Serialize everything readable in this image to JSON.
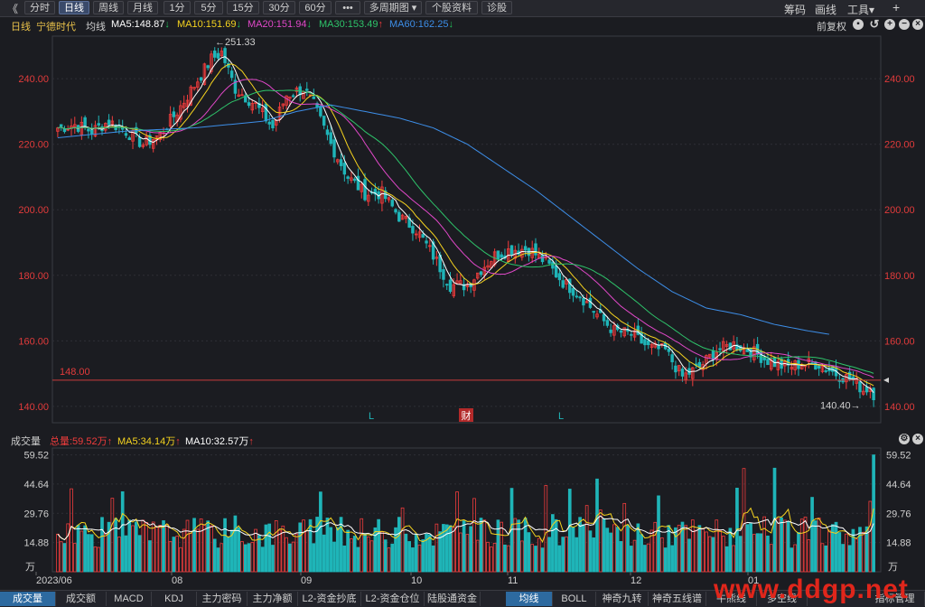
{
  "toolbar": {
    "collapse": "《",
    "buttons": [
      "分时",
      "日线",
      "周线",
      "月线",
      "1分",
      "5分",
      "15分",
      "30分",
      "60分",
      "•••",
      "多周期图",
      "个股资料",
      "诊股"
    ],
    "active": "日线",
    "multi_arrow": "▾",
    "right": [
      "筹码",
      "画线",
      "工具▾"
    ],
    "plus": "+"
  },
  "kline_header": {
    "period": "日线",
    "stock": "宁德时代",
    "ma_label": "均线",
    "ma": [
      {
        "text": "MA5:148.87",
        "arrow": "↓",
        "color": "#ffffff",
        "arrow_color": "#22c05a"
      },
      {
        "text": "MA10:151.69",
        "arrow": "↓",
        "color": "#f5d31f",
        "arrow_color": "#22c05a"
      },
      {
        "text": "MA20:151.94",
        "arrow": "↓",
        "color": "#e048c8",
        "arrow_color": "#22c05a"
      },
      {
        "text": "MA30:153.49",
        "arrow": "↑",
        "color": "#2ec36a",
        "arrow_color": "#f03c3c"
      },
      {
        "text": "MA60:162.25",
        "arrow": "↓",
        "color": "#3d8ee8",
        "arrow_color": "#22c05a"
      }
    ],
    "restore": "前复权"
  },
  "volume_header": {
    "label": "成交量",
    "total": "总量:59.52万",
    "total_arrow": "↑",
    "ma5": "MA5:34.14万",
    "ma5_arrow": "↑",
    "ma10": "MA10:32.57万",
    "ma10_arrow": "↑"
  },
  "price_axis": {
    "ticks": [
      "240.00",
      "220.00",
      "200.00",
      "180.00",
      "160.00",
      "140.00"
    ],
    "values": [
      240,
      220,
      200,
      180,
      160,
      140
    ],
    "min": 135,
    "max": 253
  },
  "price_line": {
    "value": 148.0,
    "label": "148.00"
  },
  "annotations": {
    "high": "251.33",
    "low": "140.40",
    "low_arrow": "→",
    "high_arrow": "←",
    "markers": [
      "L",
      "财",
      "L"
    ]
  },
  "volume_axis": {
    "ticks": [
      "59.52",
      "44.64",
      "29.76",
      "14.88"
    ],
    "values": [
      59.52,
      44.64,
      29.76,
      14.88
    ],
    "max": 63,
    "unit": "万"
  },
  "date_axis": [
    "2023/06",
    "08",
    "09",
    "10",
    "11",
    "12",
    "01"
  ],
  "bottom_tabs": [
    "成交量",
    "成交额",
    "MACD",
    "KDJ",
    "主力密码",
    "主力净额",
    "L2-资金抄底",
    "L2-资金仓位",
    "陆股通资金",
    "均线",
    "BOLL",
    "神奇九转",
    "神奇五线谱",
    "牛熊线",
    "多空线",
    "指标管理"
  ],
  "active_tab": "成交量",
  "watermark": "www.ddgp.net",
  "colors": {
    "up": "#f03c3c",
    "down": "#1fb5b8",
    "bg": "#1b1c21",
    "grid": "#2e2f36",
    "axis_red": "#e23b3b",
    "price_line": "#c83c3c"
  },
  "chart_data": {
    "type": "candlestick",
    "start_index_date": "2023/06",
    "ma_colors": {
      "ma5": "#ffffff",
      "ma10": "#f5d31f",
      "ma20": "#e048c8",
      "ma30": "#2ec36a",
      "ma60": "#3d8ee8"
    },
    "price_anchors": [
      [
        0,
        225
      ],
      [
        5,
        226
      ],
      [
        10,
        224
      ],
      [
        15,
        227
      ],
      [
        20,
        224
      ],
      [
        25,
        220
      ],
      [
        30,
        223
      ],
      [
        35,
        230
      ],
      [
        40,
        238
      ],
      [
        45,
        246
      ],
      [
        48,
        248
      ],
      [
        52,
        237
      ],
      [
        58,
        232
      ],
      [
        63,
        225
      ],
      [
        67,
        235
      ],
      [
        72,
        237
      ],
      [
        75,
        232
      ],
      [
        80,
        220
      ],
      [
        85,
        210
      ],
      [
        90,
        205
      ],
      [
        95,
        205
      ],
      [
        100,
        198
      ],
      [
        105,
        194
      ],
      [
        110,
        186
      ],
      [
        115,
        177
      ],
      [
        120,
        177
      ],
      [
        124,
        182
      ],
      [
        128,
        186
      ],
      [
        133,
        188
      ],
      [
        138,
        188
      ],
      [
        143,
        184
      ],
      [
        148,
        178
      ],
      [
        153,
        174
      ],
      [
        158,
        168
      ],
      [
        163,
        163
      ],
      [
        168,
        162
      ],
      [
        173,
        158
      ],
      [
        178,
        157
      ],
      [
        183,
        149
      ],
      [
        188,
        152
      ],
      [
        193,
        157
      ],
      [
        198,
        159
      ],
      [
        203,
        157
      ],
      [
        208,
        154
      ],
      [
        213,
        152
      ],
      [
        218,
        153
      ],
      [
        223,
        153
      ],
      [
        228,
        150
      ],
      [
        233,
        148
      ],
      [
        236,
        145
      ],
      [
        238,
        146
      ]
    ],
    "ma60_anchors": [
      [
        0,
        222
      ],
      [
        20,
        224
      ],
      [
        40,
        225
      ],
      [
        60,
        227
      ],
      [
        70,
        230
      ],
      [
        80,
        232
      ],
      [
        90,
        230
      ],
      [
        100,
        228
      ],
      [
        110,
        225
      ],
      [
        120,
        220
      ],
      [
        130,
        213
      ],
      [
        140,
        206
      ],
      [
        150,
        198
      ],
      [
        160,
        190
      ],
      [
        170,
        182
      ],
      [
        180,
        175
      ],
      [
        190,
        170
      ],
      [
        200,
        168
      ],
      [
        210,
        165
      ],
      [
        220,
        163
      ],
      [
        226,
        162
      ]
    ]
  }
}
